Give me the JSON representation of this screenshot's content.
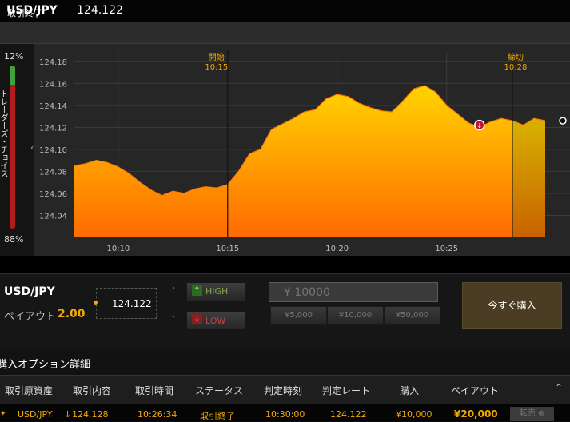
{
  "header": {
    "pair": "USD/JPY",
    "rate": "124.122"
  },
  "status": "取引終了",
  "gauge": {
    "top_pct": "12%",
    "bottom_pct": "88%",
    "label": "トレーダーズ・チョイス",
    "high_fraction": 0.12
  },
  "chart_data": {
    "type": "area",
    "ylim": [
      124.02,
      124.19
    ],
    "yticks": [
      "124.04",
      "124.06",
      "124.08",
      "124.10",
      "124.12",
      "124.14",
      "124.16",
      "124.18"
    ],
    "xticks": [
      {
        "label": "10:10",
        "t": 10.1667
      },
      {
        "label": "10:15",
        "t": 10.25
      },
      {
        "label": "10:20",
        "t": 10.3333
      },
      {
        "label": "10:25",
        "t": 10.4167
      }
    ],
    "markers": [
      {
        "label": "開始",
        "time": "10:15",
        "t": 10.25
      },
      {
        "label": "締切",
        "time": "10:28",
        "t": 10.4667
      }
    ],
    "x": [
      10.1333,
      10.1417,
      10.15,
      10.1583,
      10.1667,
      10.175,
      10.1833,
      10.1917,
      10.2,
      10.2083,
      10.2167,
      10.225,
      10.2333,
      10.2417,
      10.25,
      10.2583,
      10.2667,
      10.275,
      10.2833,
      10.2917,
      10.3,
      10.3083,
      10.3167,
      10.325,
      10.3333,
      10.3417,
      10.35,
      10.3583,
      10.3667,
      10.375,
      10.3833,
      10.3917,
      10.4,
      10.4083,
      10.4167,
      10.425,
      10.4333,
      10.4417,
      10.45,
      10.4583,
      10.4667,
      10.475,
      10.4833,
      10.4917
    ],
    "values": [
      124.085,
      124.087,
      124.09,
      124.088,
      124.084,
      124.078,
      124.07,
      124.063,
      124.058,
      124.062,
      124.06,
      124.064,
      124.066,
      124.065,
      124.068,
      124.08,
      124.096,
      124.1,
      124.118,
      124.123,
      124.128,
      124.134,
      124.136,
      124.146,
      124.15,
      124.148,
      124.142,
      124.138,
      124.135,
      124.134,
      124.144,
      124.155,
      124.158,
      124.152,
      124.14,
      124.132,
      124.124,
      124.12,
      124.125,
      124.128,
      124.126,
      124.122,
      124.128,
      124.126
    ],
    "trade_point": {
      "t": 10.4417,
      "value": 124.122
    }
  },
  "trade": {
    "pair": "USD/JPY",
    "payout_label": "ペイアウト",
    "payout": "2.00",
    "rate": "124.122",
    "high": "HIGH",
    "low": "LOW",
    "amount_placeholder": "¥ 10000",
    "quick": [
      "¥5,000",
      "¥10,000",
      "¥50,000"
    ],
    "buy_now": "今すぐ購入"
  },
  "details": {
    "title": "購入オプション詳細",
    "columns": [
      "取引原資産",
      "取引内容",
      "取引時間",
      "ステータス",
      "判定時刻",
      "判定レート",
      "購入",
      "ペイアウト"
    ],
    "row": {
      "asset": "USD/JPY",
      "content": "124.128",
      "time": "10:26:34",
      "status": "取引終了",
      "judge_time": "10:30:00",
      "judge_rate": "124.122",
      "purchase": "¥10,000",
      "payout": "¥20,000",
      "sell": "転売"
    }
  },
  "colors": {
    "accent": "#f2a900",
    "area_top": "#ffd400",
    "area_bottom": "#ff6a00",
    "down_red": "#c8102e"
  },
  "icons": {
    "high": "arrow-up-icon",
    "low": "arrow-down-icon",
    "collapse": "double-chevron-up-icon",
    "sell": "close-circle-icon",
    "row_direction": "arrow-down-icon"
  }
}
